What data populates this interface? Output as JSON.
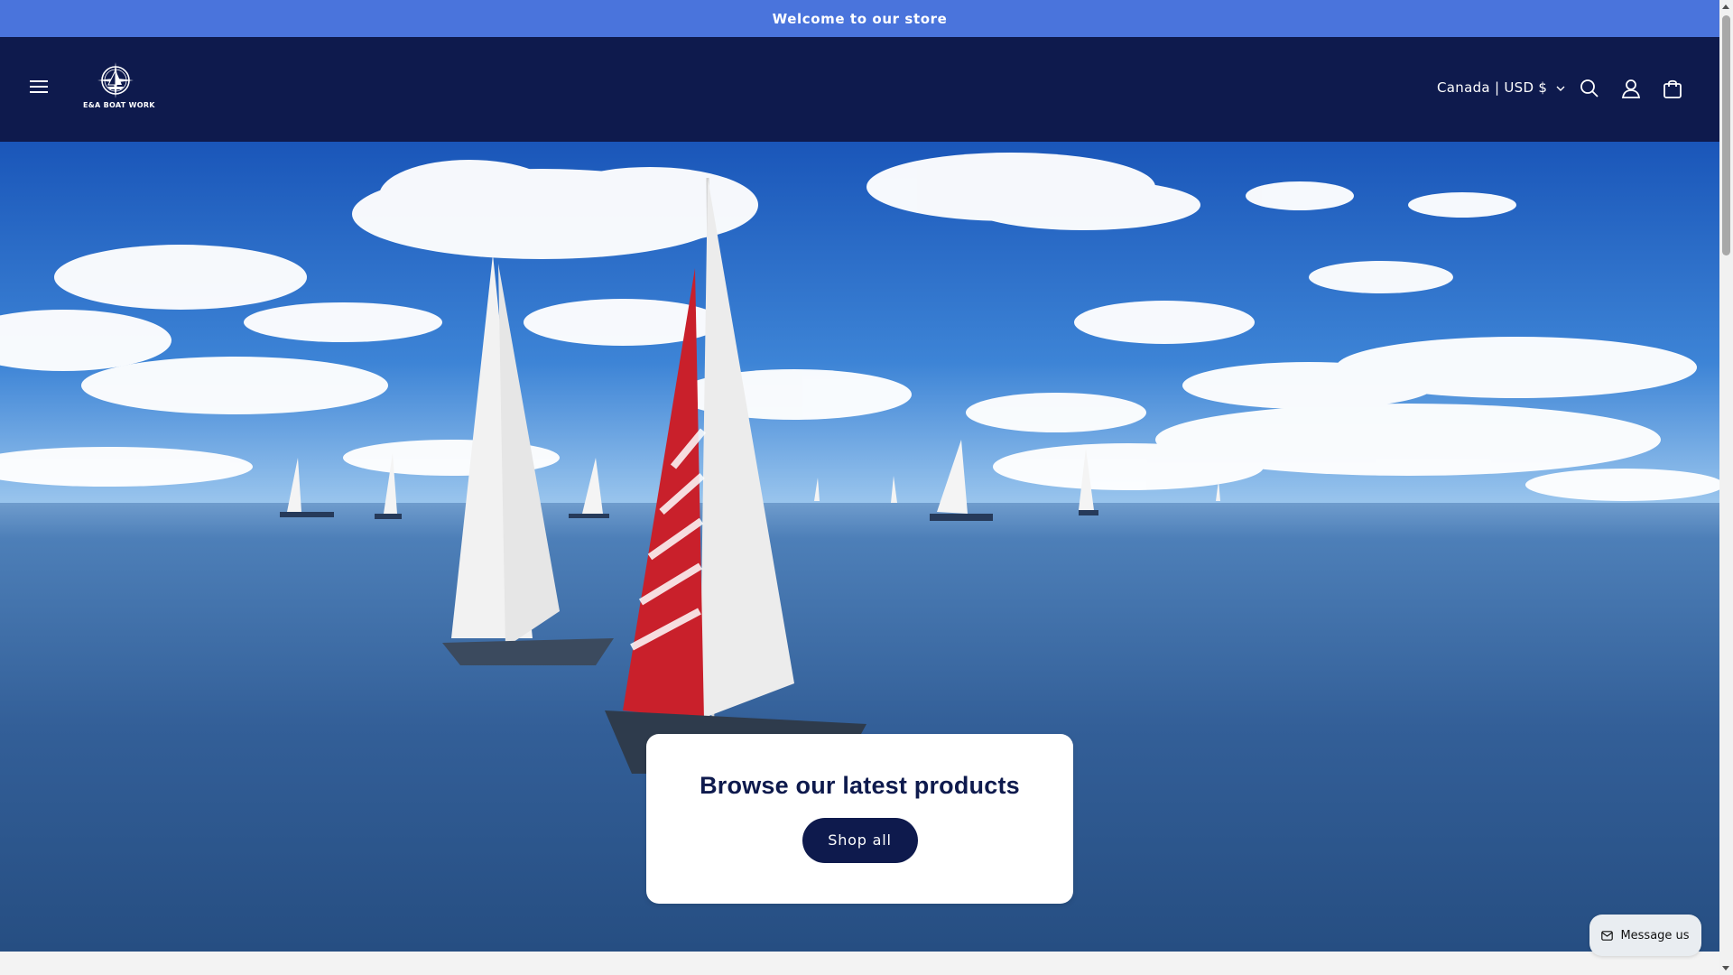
{
  "announcement": {
    "text": "Welcome to our store"
  },
  "header": {
    "logo_text": "E&A BOAT WORK",
    "localization": "Canada | USD $",
    "icons": {
      "menu": "hamburger-menu-icon",
      "search": "search-icon",
      "account": "account-icon",
      "cart": "cart-icon"
    }
  },
  "hero": {
    "heading": "Browse our latest products",
    "button_label": "Shop all"
  },
  "chat": {
    "label": "Message us",
    "icon": "message-icon"
  },
  "colors": {
    "announcement_bg": "#4a74dc",
    "header_bg": "#0e1a4d",
    "button_bg": "#0e1a4d"
  }
}
